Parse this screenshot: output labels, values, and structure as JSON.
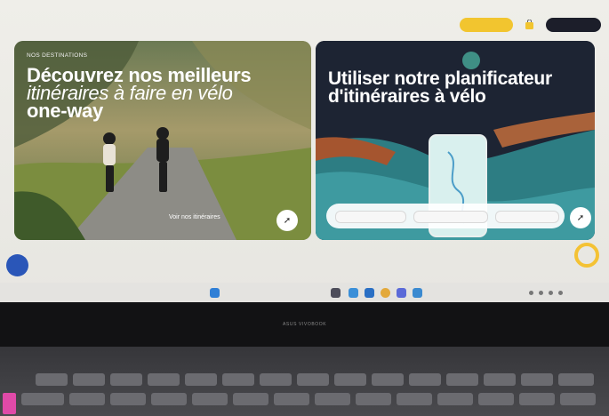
{
  "site": {
    "nav": [
      "",
      "",
      "",
      "",
      ""
    ],
    "cta_yellow": "",
    "cta_dark": ""
  },
  "left_card": {
    "tag": "NOS DESTINATIONS",
    "headline_line1": "Découvrez nos meilleurs",
    "headline_line2": "itinéraires à faire en vélo",
    "headline_line3": "one-way",
    "link": "Voir nos itinéraires"
  },
  "right_card": {
    "headline_line1": "Utiliser notre planificateur",
    "headline_line2": "d'itinéraires à vélo"
  },
  "laptop": {
    "brand": "ASUS VIVOBOOK"
  },
  "corner_badge": "",
  "colors": {
    "accent_yellow": "#f2c52f",
    "dark_navy": "#1c1e2a",
    "card_right_bg": "#1b2130",
    "badge_pink": "#e04aa8"
  }
}
